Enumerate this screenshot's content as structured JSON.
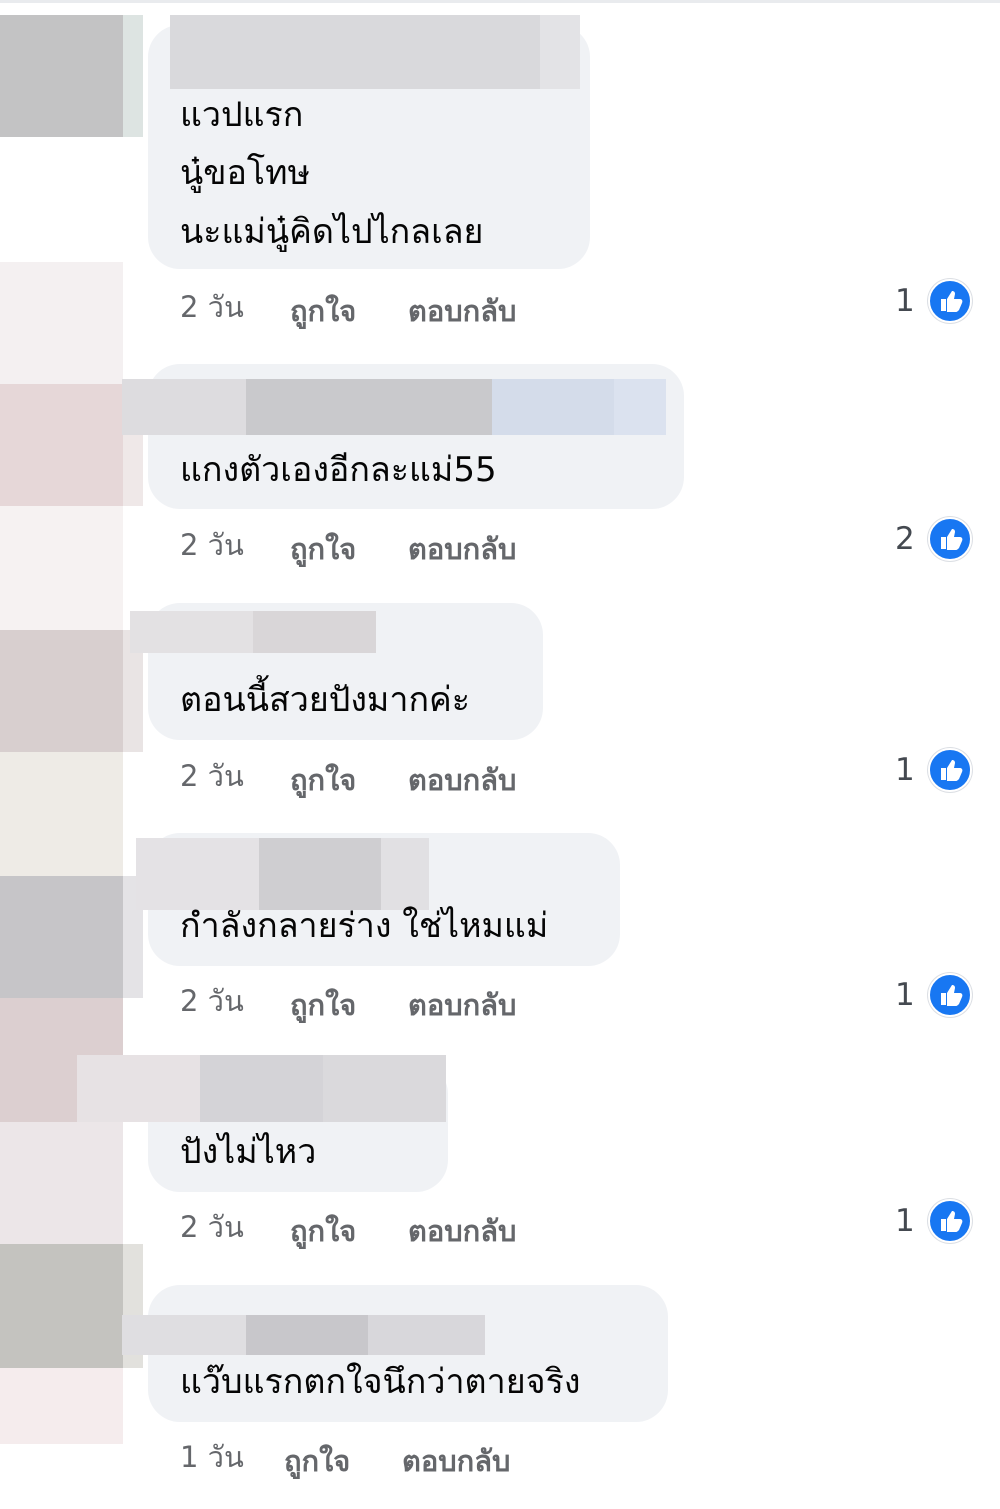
{
  "colors": {
    "bubble": "#f0f2f5",
    "meta_text": "#65676b",
    "like_badge": "#1877f2"
  },
  "comments": [
    {
      "lines": [
        "แวปแรก",
        "นู๋ขอโทษ",
        "นะแม่นู๋คิดไปไกลเลย"
      ],
      "time": "2 วัน",
      "like": "ถูกใจ",
      "reply": "ตอบกลับ",
      "reactions": "1",
      "reaction_icon": "thumbs-up-icon"
    },
    {
      "lines": [
        "แกงตัวเองอีกละแม่55"
      ],
      "time": "2 วัน",
      "like": "ถูกใจ",
      "reply": "ตอบกลับ",
      "reactions": "2",
      "reaction_icon": "thumbs-up-icon"
    },
    {
      "lines": [
        "ตอนนี้สวยปังมากค่ะ"
      ],
      "time": "2 วัน",
      "like": "ถูกใจ",
      "reply": "ตอบกลับ",
      "reactions": "1",
      "reaction_icon": "thumbs-up-icon"
    },
    {
      "lines": [
        "กำลังกลายร่าง ใช่ไหมแม่"
      ],
      "time": "2 วัน",
      "like": "ถูกใจ",
      "reply": "ตอบกลับ",
      "reactions": "1",
      "reaction_icon": "thumbs-up-icon"
    },
    {
      "lines": [
        "ปังไม่ไหว"
      ],
      "time": "2 วัน",
      "like": "ถูกใจ",
      "reply": "ตอบกลับ",
      "reactions": "1",
      "reaction_icon": "thumbs-up-icon"
    },
    {
      "lines": [
        "แว๊บแรกตกใจนึกว่าตายจริง"
      ],
      "time": "1 วัน",
      "like": "ถูกใจ",
      "reply": "ตอบกลับ",
      "reactions": "",
      "reaction_icon": ""
    }
  ]
}
